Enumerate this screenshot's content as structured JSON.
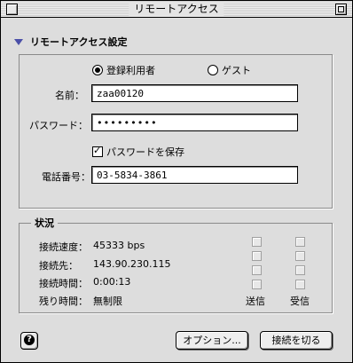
{
  "window": {
    "title": "リモートアクセス"
  },
  "section": {
    "title": "リモートアクセス設定"
  },
  "user_type": {
    "registered_label": "登録利用者",
    "guest_label": "ゲスト",
    "selected": "registered"
  },
  "form": {
    "name_label": "名前：",
    "name_value": "zaa00120",
    "password_label": "パスワード：",
    "password_value": "•••••••••",
    "save_password_label": "パスワードを保存",
    "save_password_checked": true,
    "phone_label": "電話番号：",
    "phone_value": "03-5834-3861"
  },
  "status": {
    "title": "状況",
    "speed_label": "接続速度：",
    "speed_value": "45333 bps",
    "dest_label": "接続先：",
    "dest_value": "143.90.230.115",
    "time_label": "接続時間：",
    "time_value": "0:00:13",
    "remaining_label": "残り時間：",
    "remaining_value": "無制限",
    "send_label": "送信",
    "receive_label": "受信"
  },
  "buttons": {
    "options_label": "オプション...",
    "disconnect_label": "接続を切る"
  },
  "icons": {
    "help": "?"
  }
}
